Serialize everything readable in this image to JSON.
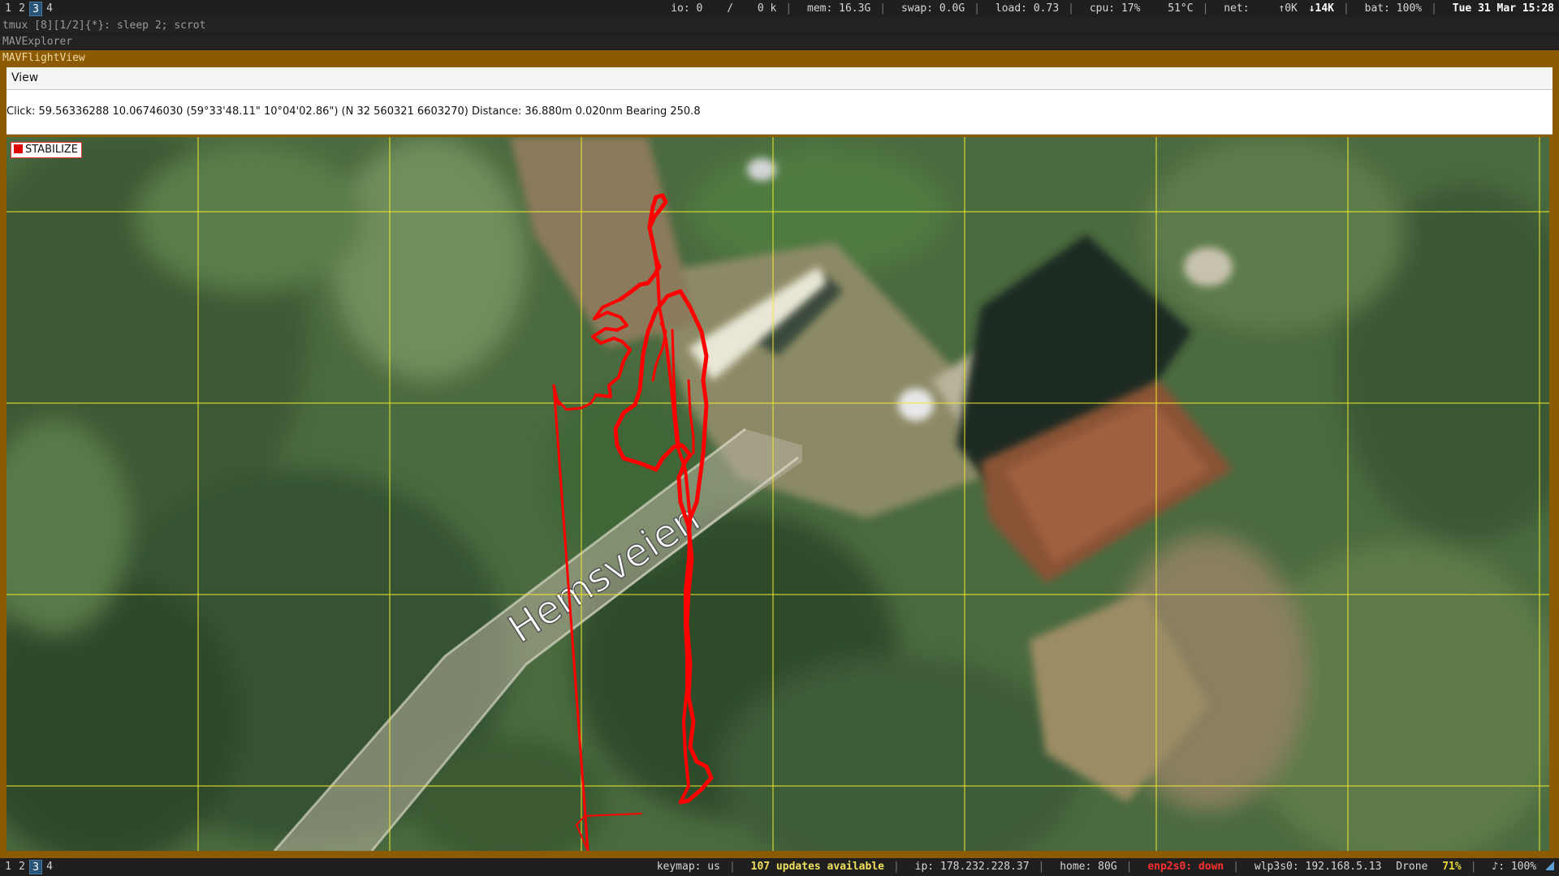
{
  "workspaces": [
    "1",
    "2",
    "3",
    "4"
  ],
  "active_workspace": "3",
  "top_status": {
    "io": "io: 0",
    "io_slash": "/",
    "io_k": "0 k",
    "mem": "mem: 16.3G",
    "swap": "swap: 0.0G",
    "load": "load: 0.73",
    "cpu": "cpu:  17%",
    "temp": "51°C",
    "net": "net:",
    "up": "↑0K",
    "down": "↓14K",
    "bat": "bat: 100%",
    "datetime": "Tue 31 Mar 15:28"
  },
  "tmux_line": "tmux [8][1/2]{*}:  sleep 2; scrot",
  "window_titles": {
    "explorer": "MAVExplorer",
    "flightview": "MAVFlightView"
  },
  "menu": {
    "view": "View"
  },
  "info": {
    "click": "Click: 59.56336288 10.06746030 (59°33'48.11\" 10°04'02.86\") (N 32 560321 6603270)  Distance: 36.880m 0.020nm Bearing 250.8"
  },
  "map": {
    "mode": "STABILIZE",
    "road_label": "Hemsveien",
    "track_color": "#ff0000",
    "grid_color": "#f2ea2a"
  },
  "bottom_status": {
    "keymap": "keymap: us",
    "updates": "107 updates available",
    "ip": "ip: 178.232.228.37",
    "home": "home: 80G",
    "enp": "enp2s0: down",
    "wlp": "wlp3s0: 192.168.5.13",
    "ssid": "Drone",
    "signal": "71%",
    "volume": "♪: 100%"
  }
}
